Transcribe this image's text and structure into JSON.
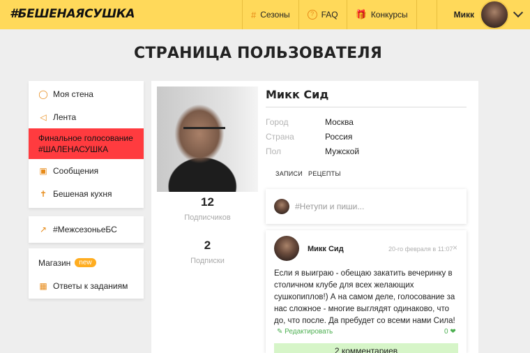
{
  "header": {
    "logo": "#БЕШЕНАЯСУШКА",
    "nav": [
      {
        "label": "Сезоны",
        "icon": "hash-icon"
      },
      {
        "label": "FAQ",
        "icon": "question-icon"
      },
      {
        "label": "Конкурсы",
        "icon": "gift-icon"
      }
    ],
    "user_name": "Микк"
  },
  "page_title": "СТРАНИЦА ПОЛЬЗОВАТЕЛЯ",
  "sidebar": {
    "group1": [
      {
        "label": "Моя стена",
        "icon": "user-icon"
      },
      {
        "label": "Лента",
        "icon": "megaphone-icon"
      },
      {
        "label": "Финальное голосование #ШАЛЕНАСУШКА",
        "active": true
      },
      {
        "label": "Сообщения",
        "icon": "chat-icon"
      },
      {
        "label": "Бешеная кухня",
        "icon": "cutlery-icon"
      }
    ],
    "group2": [
      {
        "label": "#МежсезоньеБС",
        "icon": "arrows-icon"
      }
    ],
    "group3": [
      {
        "label": "Магазин",
        "badge": "new"
      },
      {
        "label": "Ответы к заданиям",
        "icon": "box-icon"
      }
    ]
  },
  "profile": {
    "name": "Микк Сид",
    "followers_count": "12",
    "followers_label": "Подписчиков",
    "following_count": "2",
    "following_label": "Подписки",
    "info": [
      {
        "key": "Город",
        "value": "Москва"
      },
      {
        "key": "Страна",
        "value": "Россия"
      },
      {
        "key": "Пол",
        "value": "Мужской"
      }
    ],
    "tabs": [
      "ЗАПИСИ",
      "РЕЦЕПТЫ"
    ]
  },
  "new_post": {
    "placeholder": "#Нетупи и пиши..."
  },
  "post": {
    "author": "Микк Сид",
    "date": "20-го февраля в 11:07",
    "close": "×",
    "text": "Если я выиграю - обещаю закатить вечеринку в столичном клубе для всех желающих сушкопиплов!) А на самом деле, голосование за нас сложное - многие выглядят одинаково, что до, что после. Да пребудет со всеми нами Сила!",
    "edit_label": "Редактировать",
    "likes": "0",
    "comments_label": "2 комментариев"
  },
  "colors": {
    "header_bg": "#ffd95a",
    "accent": "#e78a17",
    "active_item": "#ff3b3f",
    "green": "#4caf50"
  }
}
